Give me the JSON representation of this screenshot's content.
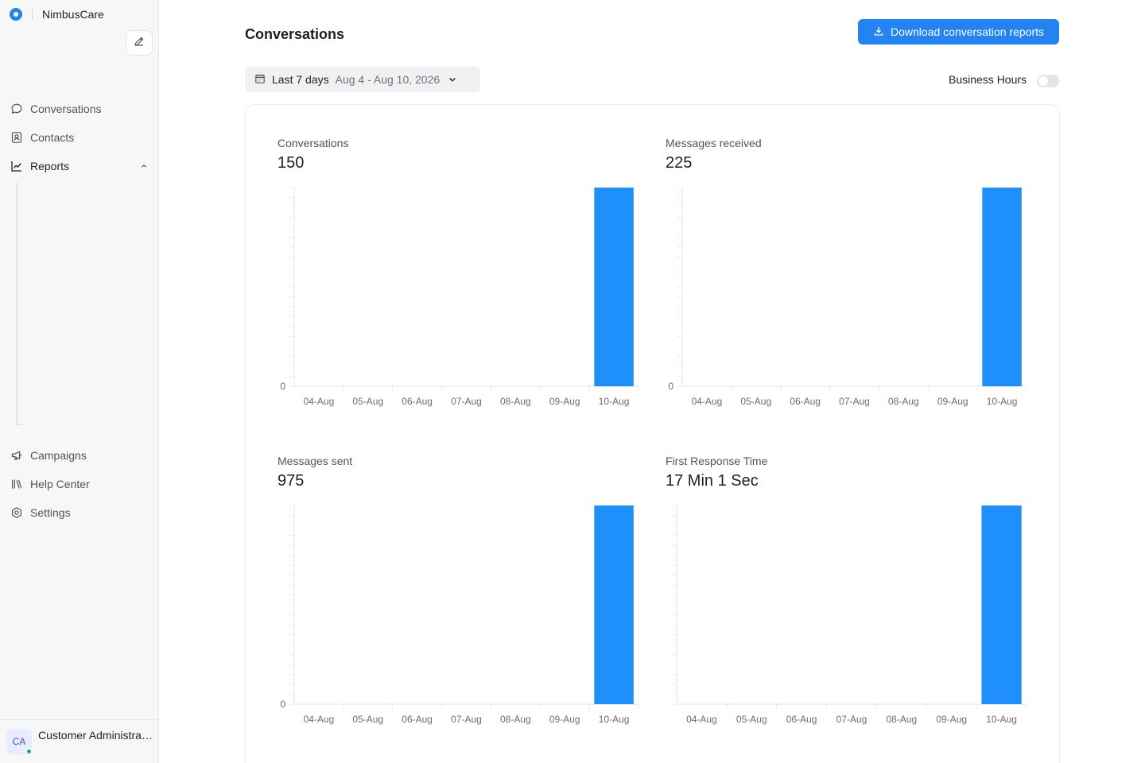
{
  "brand": {
    "name": "NimbusCare"
  },
  "sidebar": {
    "items": [
      {
        "label": "Conversations",
        "icon": "chat-bubble-icon"
      },
      {
        "label": "Contacts",
        "icon": "contact-card-icon"
      },
      {
        "label": "Reports",
        "icon": "line-chart-icon"
      },
      {
        "label": "Campaigns",
        "icon": "megaphone-icon"
      },
      {
        "label": "Help Center",
        "icon": "library-icon"
      },
      {
        "label": "Settings",
        "icon": "gear-icon"
      }
    ]
  },
  "user": {
    "initials": "CA",
    "name": "Customer Administrator",
    "status_color": "#12a37a"
  },
  "header": {
    "title": "Conversations",
    "download_label": "Download conversation reports"
  },
  "filter": {
    "label": "Last 7 days",
    "range": "Aug 4 - Aug 10, 2026"
  },
  "business_hours": {
    "label": "Business Hours",
    "enabled": false
  },
  "colors": {
    "accent": "#2483f2",
    "bar": "#1f8ffb"
  },
  "metrics": [
    {
      "label": "Conversations",
      "value": "150"
    },
    {
      "label": "Messages received",
      "value": "225"
    },
    {
      "label": "Messages sent",
      "value": "975"
    },
    {
      "label": "First Response Time",
      "value": "17 Min 1 Sec"
    }
  ],
  "chart_data": [
    {
      "type": "bar",
      "title": "Conversations",
      "categories": [
        "04-Aug",
        "05-Aug",
        "06-Aug",
        "07-Aug",
        "08-Aug",
        "09-Aug",
        "10-Aug"
      ],
      "values": [
        0,
        0,
        0,
        0,
        0,
        0,
        150
      ],
      "y_tick_labels": [
        "0"
      ],
      "ylim": [
        0,
        150
      ],
      "grid": false
    },
    {
      "type": "bar",
      "title": "Messages received",
      "categories": [
        "04-Aug",
        "05-Aug",
        "06-Aug",
        "07-Aug",
        "08-Aug",
        "09-Aug",
        "10-Aug"
      ],
      "values": [
        0,
        0,
        0,
        0,
        0,
        0,
        225
      ],
      "y_tick_labels": [
        "0"
      ],
      "ylim": [
        0,
        225
      ],
      "grid": false
    },
    {
      "type": "bar",
      "title": "Messages sent",
      "categories": [
        "04-Aug",
        "05-Aug",
        "06-Aug",
        "07-Aug",
        "08-Aug",
        "09-Aug",
        "10-Aug"
      ],
      "values": [
        0,
        0,
        0,
        0,
        0,
        0,
        975
      ],
      "y_tick_labels": [
        "0"
      ],
      "ylim": [
        0,
        975
      ],
      "grid": false
    },
    {
      "type": "bar",
      "title": "First Response Time",
      "categories": [
        "04-Aug",
        "05-Aug",
        "06-Aug",
        "07-Aug",
        "08-Aug",
        "09-Aug",
        "10-Aug"
      ],
      "values": [
        0,
        0,
        0,
        0,
        0,
        0,
        1021
      ],
      "y_tick_labels": [],
      "ylim": [
        0,
        1021
      ],
      "grid": false
    }
  ]
}
